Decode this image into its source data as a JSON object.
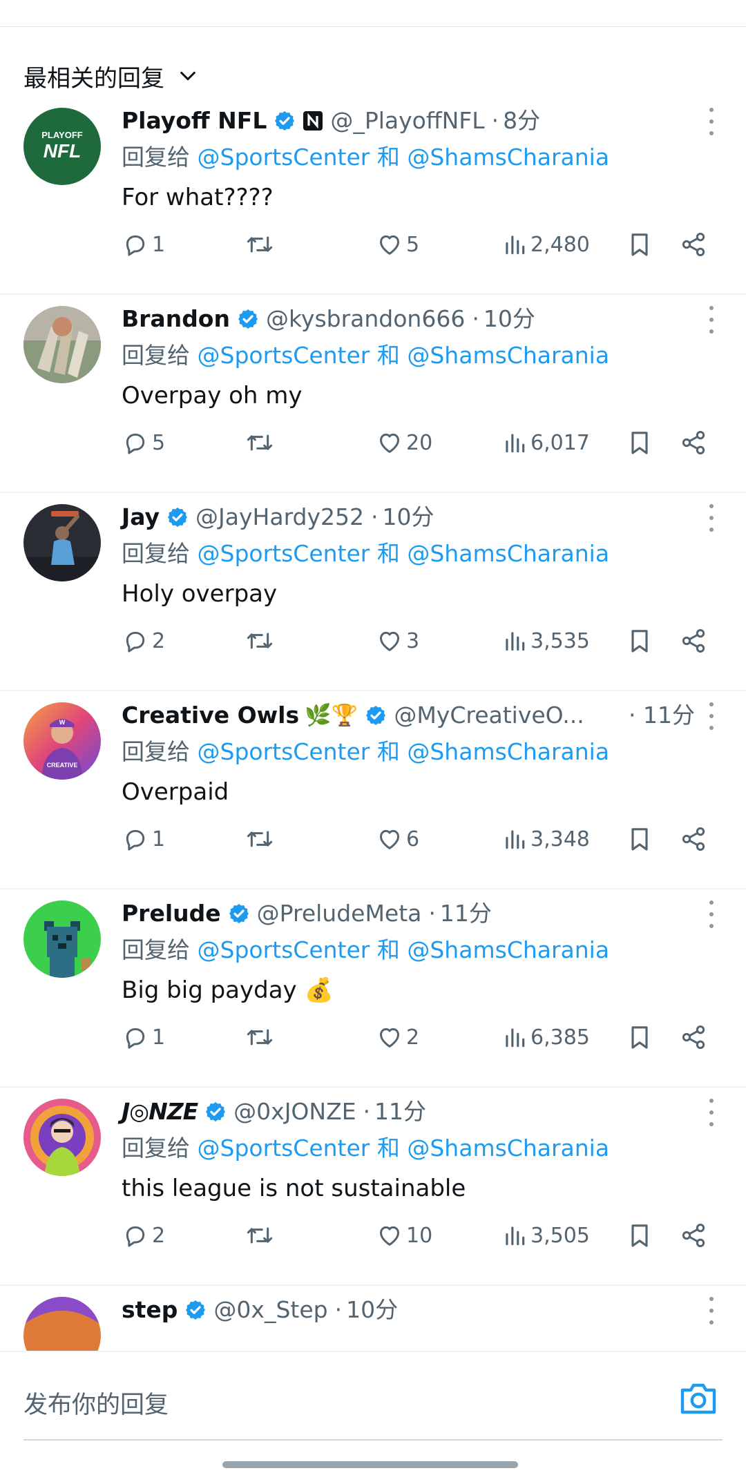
{
  "header": {
    "sort_label": "最相关的回复"
  },
  "common": {
    "replying_prefix": "回复给",
    "mention_1": "@SportsCenter",
    "and_word": "和",
    "mention_2": "@ShamsCharania"
  },
  "replies": [
    {
      "name": "Playoff NFL",
      "handle": "@_PlayoffNFL",
      "time": "8分",
      "text": "For what????",
      "replies": "1",
      "retweets": "",
      "likes": "5",
      "views": "2,480",
      "avatar_text": [
        "PLAYOFF",
        "NFL"
      ]
    },
    {
      "name": "Brandon",
      "handle": "@kysbrandon666",
      "time": "10分",
      "text": "Overpay oh my",
      "replies": "5",
      "retweets": "",
      "likes": "20",
      "views": "6,017"
    },
    {
      "name": "Jay",
      "handle": "@JayHardy252",
      "time": "10分",
      "text": "Holy overpay",
      "replies": "2",
      "retweets": "",
      "likes": "3",
      "views": "3,535"
    },
    {
      "name": "Creative Owls",
      "name_emoji": "🌿🏆",
      "handle": "@MyCreativeO...",
      "time": "11分",
      "text": "Overpaid",
      "replies": "1",
      "retweets": "",
      "likes": "6",
      "views": "3,348",
      "avatar_text": [
        "W",
        "CREATIVE"
      ]
    },
    {
      "name": "Prelude",
      "handle": "@PreludeMeta",
      "time": "11分",
      "text": "Big big payday 💰",
      "replies": "1",
      "retweets": "",
      "likes": "2",
      "views": "6,385"
    },
    {
      "name": "J◎NZE",
      "handle": "@0xJONZE",
      "time": "11分",
      "text": "this league is not sustainable",
      "replies": "2",
      "retweets": "",
      "likes": "10",
      "views": "3,505"
    },
    {
      "name": "step",
      "handle": "@0x_Step",
      "time": "10分"
    }
  ],
  "compose": {
    "placeholder": "发布你的回复"
  },
  "colors": {
    "accent": "#1d9bf0",
    "secondary_text": "#536471",
    "nfl_green": "#1f6a3d"
  },
  "icons": [
    "chevron-down-icon",
    "verified-badge-icon",
    "more-icon",
    "reply-icon",
    "retweet-icon",
    "like-icon",
    "views-icon",
    "bookmark-icon",
    "share-icon",
    "camera-icon"
  ]
}
